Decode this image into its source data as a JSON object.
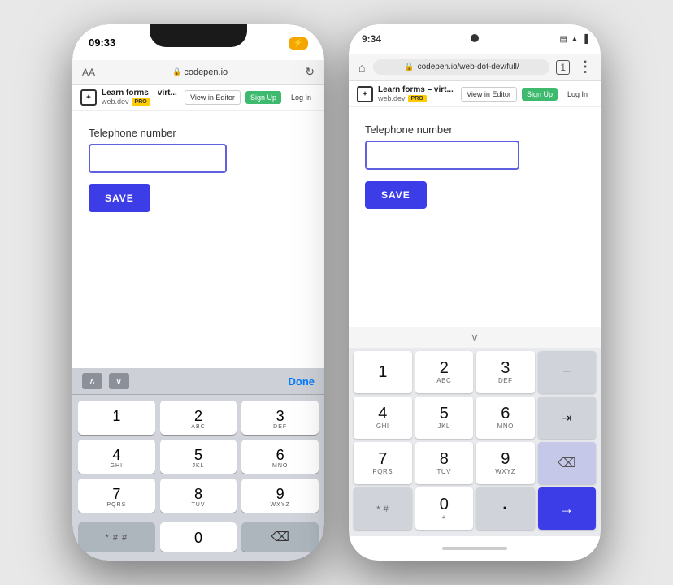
{
  "leftPhone": {
    "statusTime": "09:33",
    "batteryLabel": "⚡",
    "addressUrl": "codepen.io",
    "codepenTitle": "Learn forms – virt...",
    "codepenDomain": "web.dev",
    "proBadge": "PRO",
    "viewInEditor": "View in Editor",
    "signUp": "Sign Up",
    "logIn": "Log In",
    "formLabel": "Telephone number",
    "saveButton": "SAVE",
    "keyboardDone": "Done",
    "keys": [
      {
        "num": "1",
        "alpha": ""
      },
      {
        "num": "2",
        "alpha": "ABC"
      },
      {
        "num": "3",
        "alpha": "DEF"
      },
      {
        "num": "4",
        "alpha": "GHI"
      },
      {
        "num": "5",
        "alpha": "JKL"
      },
      {
        "num": "6",
        "alpha": "MNO"
      },
      {
        "num": "7",
        "alpha": "PQRS"
      },
      {
        "num": "8",
        "alpha": "TUV"
      },
      {
        "num": "9",
        "alpha": "WXYZ"
      }
    ],
    "bottomRow": [
      "* # #",
      "0",
      "⌫"
    ]
  },
  "rightPhone": {
    "statusTime": "9:34",
    "addressUrl": "codepen.io/web-dot-dev/full/",
    "codepenTitle": "Learn forms – virt...",
    "codepenDomain": "web.dev",
    "proBadge": "PRO",
    "viewInEditor": "View in Editor",
    "signUp": "Sign Up",
    "logIn": "Log In",
    "formLabel": "Telephone number",
    "saveButton": "SAVE",
    "keys": [
      {
        "num": "1",
        "alpha": ""
      },
      {
        "num": "2",
        "alpha": "ABC"
      },
      {
        "num": "3",
        "alpha": "DEF"
      },
      {
        "num": "4",
        "alpha": "GHI"
      },
      {
        "num": "5",
        "alpha": "JKL"
      },
      {
        "num": "6",
        "alpha": "MNO"
      },
      {
        "num": "7",
        "alpha": "PQRS"
      },
      {
        "num": "8",
        "alpha": "TUV"
      },
      {
        "num": "9",
        "alpha": "WXYZ"
      }
    ],
    "bottomRow": [
      {
        "label": "* #"
      },
      {
        "label": "0",
        "sub": "+"
      },
      {
        "label": "."
      }
    ],
    "backspace": "⌫",
    "enter": "→"
  }
}
